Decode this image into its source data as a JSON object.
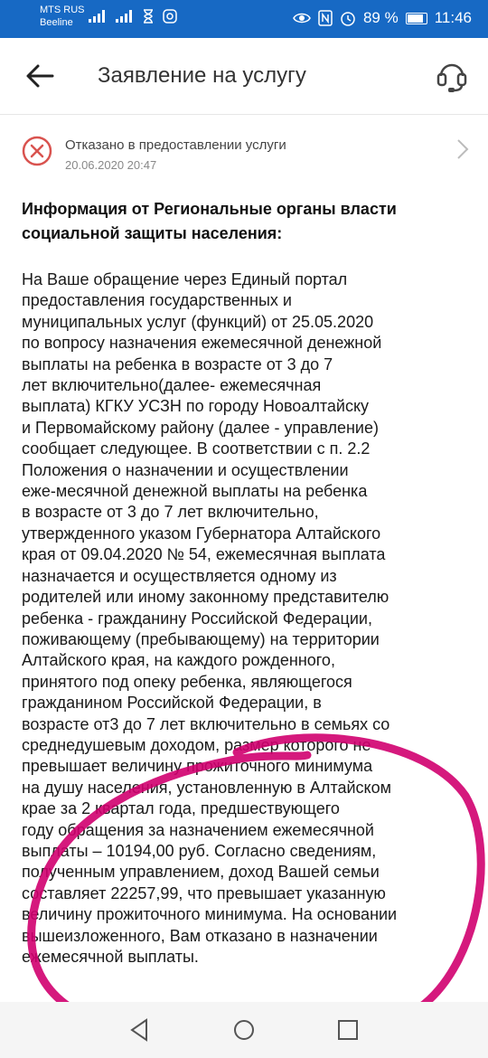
{
  "statusbar": {
    "carrier1": "MTS RUS",
    "carrier2": "Beeline",
    "battery": "89 %",
    "time": "11:46"
  },
  "appbar": {
    "title": "Заявление на услугу",
    "back_icon": "arrow-left-icon",
    "support_icon": "headset-icon"
  },
  "status": {
    "text": "Отказано в предоставлении услуги",
    "date": "20.06.2020 20:47",
    "icon": "error-circle-icon",
    "color": "#d9534f"
  },
  "info": {
    "heading": "Информация от Региональные органы власти социальной защиты населения:",
    "lines": [
      "На Ваше обращение через Единый портал",
      "предоставления государственных и",
      "муниципальных услуг (функций) от 25.05.2020",
      "по вопросу назначения ежемесячной денежной",
      "выплаты на ребенка в возрасте от 3 до 7",
      "лет включительно(далее- ежемесячная",
      "выплата) КГКУ УСЗН по городу Новоалтайску",
      "и Первомайскому району (далее - управление)",
      "сообщает следующее. В соответствии с п. 2.2",
      "Положения о назначении и осуществлении",
      "еже-месячной денежной выплаты на ребенка",
      "в возрасте от 3 до 7 лет включительно,",
      "утвержденного указом Губернатора Алтайского",
      "края от 09.04.2020 № 54, ежемесячная выплата",
      "назначается и осуществляется одному из",
      "родителей или иному законному представителю",
      "ребенка - гражданину Российской Федерации,",
      "поживающему (пребывающему) на территории",
      "Алтайского края, на каждого рожденного,",
      "принятого под опеку ребенка, являющегося",
      "гражданином Российской Федерации, в",
      "возрасте от3 до 7 лет включительно в семьях со",
      "среднедушевым доходом, размер которого не",
      "превышает величину прожиточного минимума",
      "на душу населения, установленную в Алтайском",
      "крае за 2 квартал года, предшествующего",
      "году обращения за назначением ежемесячной",
      "выплаты – 10194,00 руб. Согласно сведениям,",
      "полученным управлением, доход Вашей семьи",
      "составляет 22257,99, что превышает указанную",
      "величину прожиточного минимума. На основании",
      "вышеизложенного, Вам отказано в назначении",
      "ежемесячной выплаты."
    ]
  },
  "navbar": {
    "back": "nav-back-icon",
    "home": "nav-home-icon",
    "recent": "nav-recent-icon"
  },
  "annotation_color": "#d0006f"
}
